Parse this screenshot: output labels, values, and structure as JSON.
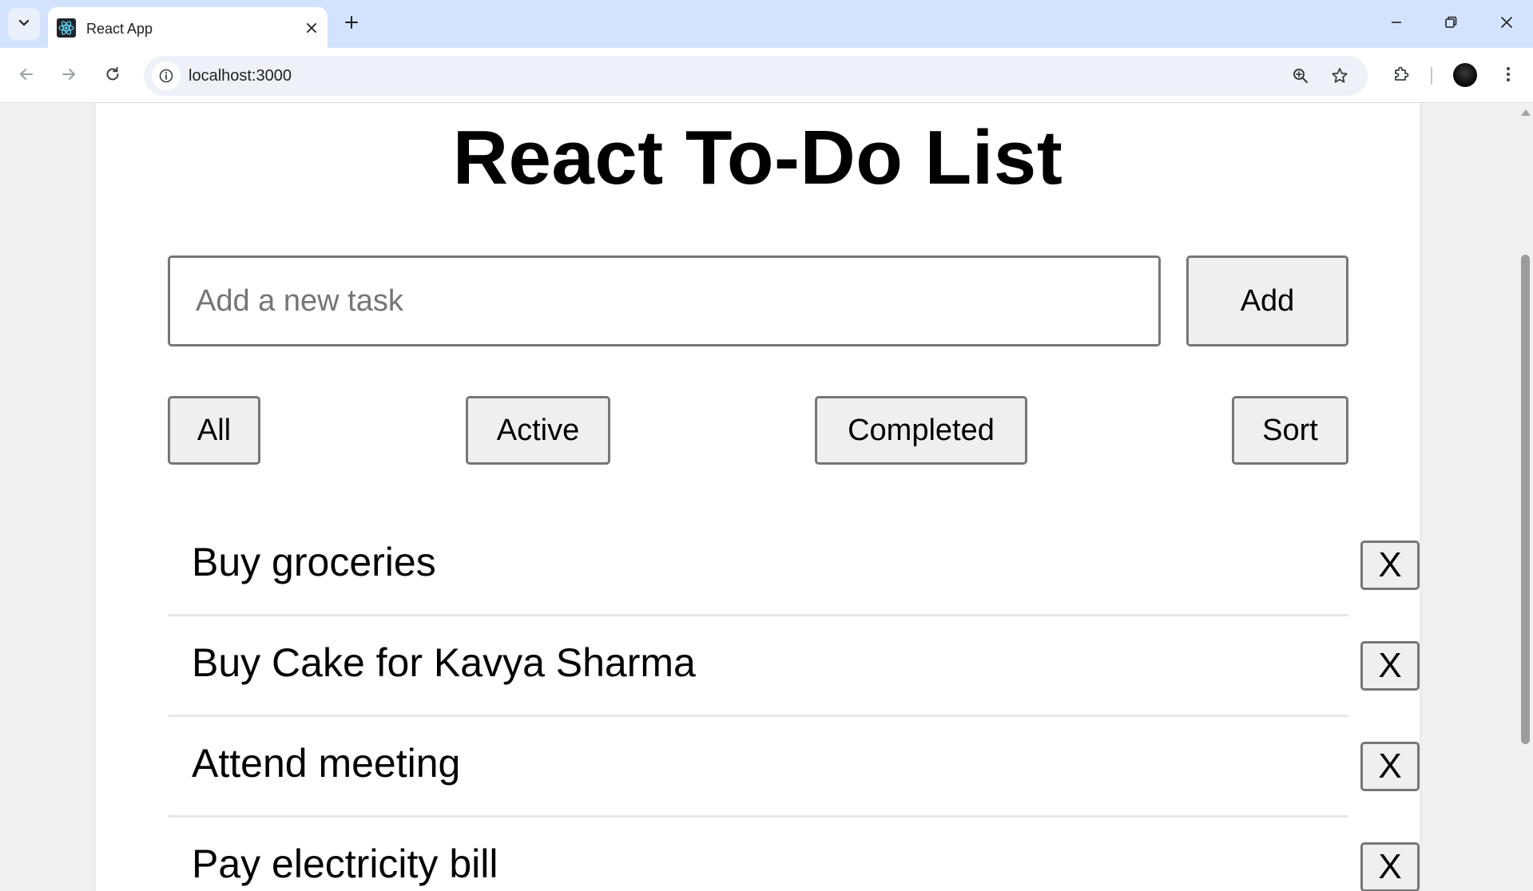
{
  "browser": {
    "tab_title": "React App",
    "url": "localhost:3000"
  },
  "app": {
    "title": "React To-Do List",
    "input_placeholder": "Add a new task",
    "input_value": "",
    "add_label": "Add",
    "filters": [
      "All",
      "Active",
      "Completed"
    ],
    "sort_label": "Sort",
    "todos": [
      {
        "text": "Buy groceries",
        "delete_label": "X"
      },
      {
        "text": "Buy Cake for Kavya Sharma",
        "delete_label": "X"
      },
      {
        "text": "Attend meeting",
        "delete_label": "X"
      },
      {
        "text": "Pay electricity bill",
        "delete_label": "X"
      }
    ]
  },
  "icons": {
    "favicon": "react-logo-icon",
    "tab_search": "chevron-down-icon",
    "tab_close": "close-icon",
    "new_tab": "plus-icon",
    "back": "arrow-left-icon",
    "forward": "arrow-right-icon",
    "reload": "reload-icon",
    "site_info": "info-icon",
    "zoom": "zoom-in-icon",
    "bookmark": "star-icon",
    "extensions": "puzzle-icon",
    "menu": "more-vert-icon"
  },
  "colors": {
    "tabstrip": "#d3e3fd",
    "react_blue": "#61dafb",
    "button_bg": "#efefef",
    "button_border": "#767676"
  }
}
